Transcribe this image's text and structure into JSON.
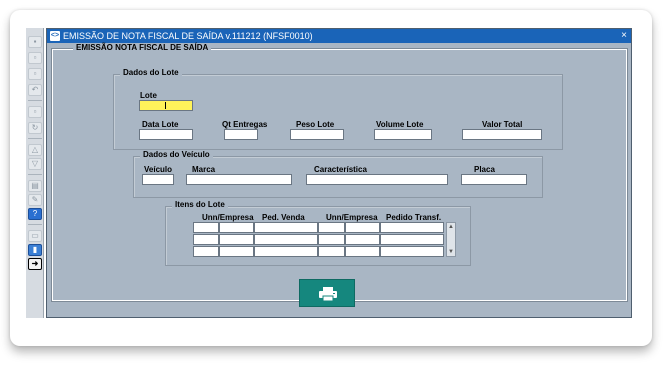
{
  "window": {
    "title": "EMISSÃO DE NOTA FISCAL DE SAÍDA v.111212 (NFSF0010)",
    "close_glyph": "×"
  },
  "form": {
    "title": "EMISSÃO NOTA FISCAL DE SAÍDA",
    "lote_group": {
      "title": "Dados do Lote",
      "lote_label": "Lote",
      "lote_value": "",
      "data_lote_label": "Data Lote",
      "qt_entregas_label": "Qt Entregas",
      "peso_lote_label": "Peso Lote",
      "volume_lote_label": "Volume Lote",
      "valor_total_label": "Valor Total"
    },
    "veiculo_group": {
      "title": "Dados do Veículo",
      "veiculo_label": "Veículo",
      "marca_label": "Marca",
      "caracteristica_label": "Característica",
      "placa_label": "Placa"
    },
    "itens_group": {
      "title": "Itens do Lote",
      "columns": [
        "Unn/Empresa",
        "Ped. Venda",
        "Unn/Empresa",
        "Pedido Transf."
      ]
    }
  },
  "icons": {
    "print": "printer-icon",
    "app": "oracle-forms-icon"
  },
  "colors": {
    "titlebar": "#1a64b8",
    "window_bg": "#a9b6c4",
    "active_field": "#fff35a",
    "print_button": "#15877e"
  }
}
